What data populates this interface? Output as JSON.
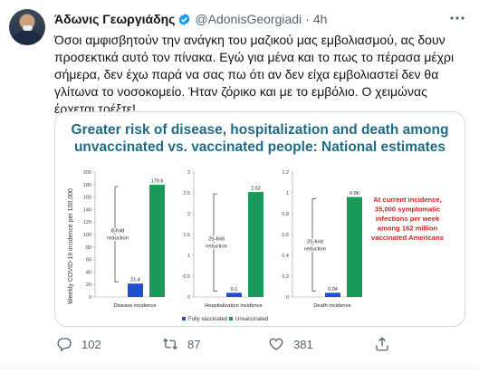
{
  "tweet": {
    "author_name": "Άδωνις Γεωργιάδης",
    "handle": "@AdonisGeorgiadi",
    "separator": "·",
    "time": "4h",
    "text": "Όσοι αμφισβητούν την ανάγκη του μαζικού μας εμβολιασμού, ας δουν\nπροσεκτικά αυτό τον πίνακα. Εγώ για μένα και το πως το πέρασα μέχρι\nσήμερα, δεν έχω παρά να σας πω ότι αν δεν είχα εμβολιαστεί δεν θα\nγλίτωνα το νοσοκομείο. Ήταν ζόρικο και με το εμβόλιο. Ο χειμώνας\nέρχεται τρέξτε!",
    "icons": {
      "verified": "verified-badge-icon",
      "more": "more-options-icon",
      "reply": "reply-icon",
      "retweet": "retweet-icon",
      "like": "like-icon",
      "share": "share-icon"
    },
    "colors": {
      "verified": "#1d9bf0",
      "muted": "#536471"
    }
  },
  "actions": {
    "reply_count": "102",
    "retweet_count": "87",
    "like_count": "381"
  },
  "infographic": {
    "title_line1": "Greater risk of disease, hospitalization and death among",
    "title_line2": "unvaccinated vs. vaccinated people: National estimates",
    "ylabel": "Weekly COVID-19 incidence per 100,000",
    "side_note": [
      "At current incidence,",
      "35,000 symptomatic",
      "infections per week",
      "among 162 million",
      "vaccinated Americans"
    ],
    "legend_fully": "Fully vaccinated",
    "legend_unvax": "Unvaccinated",
    "colors": {
      "title": "#1f6b85",
      "vaccinated": "#1f4fd1",
      "unvaccinated": "#1a9a5a",
      "note": "#d42020"
    }
  },
  "chart_data": [
    {
      "type": "bar",
      "categories": [
        "Fully vaccinated",
        "Unvaccinated"
      ],
      "values": [
        21.4,
        179.6
      ],
      "ylim": [
        0,
        200
      ],
      "yticks": [
        0,
        20,
        40,
        60,
        80,
        100,
        120,
        140,
        160,
        180,
        200
      ],
      "value_labels": [
        "21.4",
        "179.6"
      ],
      "xlabel": "Disease incidence",
      "annotation": [
        "8-fold",
        "reduction"
      ]
    },
    {
      "type": "bar",
      "categories": [
        "Fully vaccinated",
        "Unvaccinated"
      ],
      "values": [
        0.1,
        2.52
      ],
      "ylim": [
        0,
        3
      ],
      "yticks": [
        0,
        0.5,
        1,
        1.5,
        2,
        2.5,
        3
      ],
      "value_labels": [
        "0.1",
        "2.52"
      ],
      "xlabel": "Hospitalization incidence",
      "annotation": [
        "25-fold",
        "reduction"
      ]
    },
    {
      "type": "bar",
      "categories": [
        "Fully vaccinated",
        "Unvaccinated"
      ],
      "values": [
        0.04,
        0.96
      ],
      "ylim": [
        0,
        1.2
      ],
      "yticks": [
        0,
        0.2,
        0.4,
        0.6,
        0.8,
        1.0,
        1.2
      ],
      "value_labels": [
        "0.04",
        "0.96"
      ],
      "xlabel": "Death incidence",
      "annotation": [
        "25-fold",
        "reduction"
      ]
    }
  ]
}
